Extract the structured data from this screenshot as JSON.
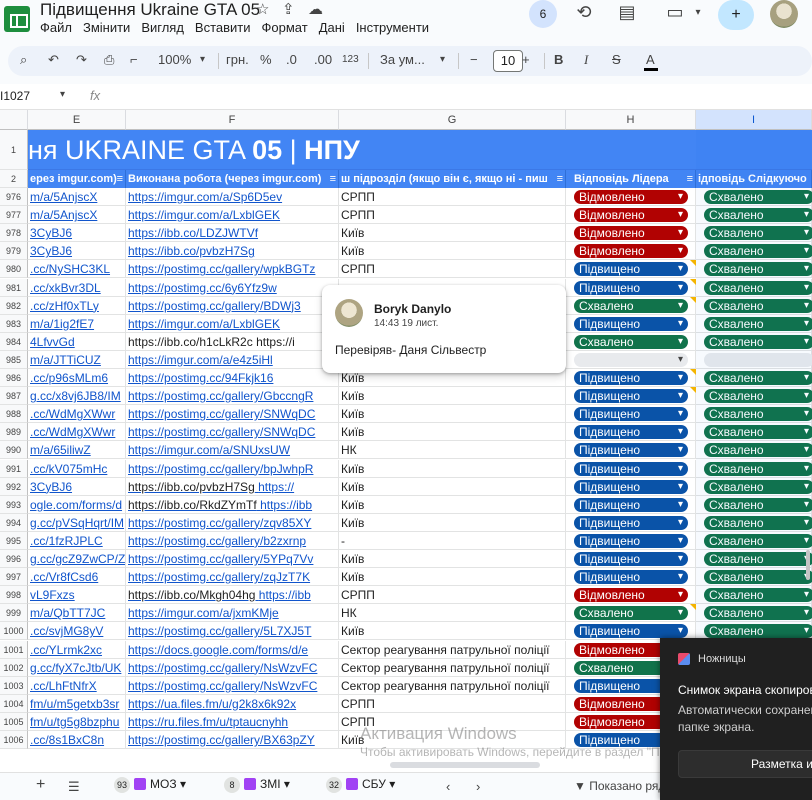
{
  "app": {
    "title": "Підвищення Ukraine GTA 05",
    "menu": [
      "Файл",
      "Змінити",
      "Вигляд",
      "Вставити",
      "Формат",
      "Дані",
      "Інструменти"
    ],
    "collaborators_count": "6"
  },
  "toolbar": {
    "zoom": "100%",
    "currency": "грн.",
    "percent": "%",
    "decrease_decimals": ".0",
    "increase_decimals": ".00",
    "number_format": "123",
    "font": "За ум...",
    "font_size": "10",
    "minus": "−",
    "plus": "+",
    "bold": "B",
    "italic": "I",
    "strike": "S",
    "text_color": "A"
  },
  "formula_bar": {
    "name_box": "I1027",
    "fx": "fx"
  },
  "columns": [
    "E",
    "F",
    "G",
    "H",
    "I"
  ],
  "banner": {
    "prefix": "ня UKRAINE GTA ",
    "bold_num": "05",
    "sep": " | ",
    "suffix": "НПУ"
  },
  "header_row": {
    "row_num": "2",
    "e": "ерез imgur.com)",
    "f": "Виконана робота (через imgur.com)",
    "g": "ш підрозділ (якщо він є, якщо ні - пиш",
    "h": "Відповідь Лідера",
    "i": "ідповідь Слідкуючо"
  },
  "banner_row_num": "1",
  "rows": [
    {
      "n": "976",
      "e": "m/a/5AnjscX",
      "f": "https://imgur.com/a/Sp6D5ev",
      "g": "СРПП",
      "h": "Відмовлено",
      "hc": "red",
      "i": "Схвалено"
    },
    {
      "n": "977",
      "e": "m/a/5AnjscX",
      "f": "https://imgur.com/a/LxblGEK",
      "g": "СРПП",
      "h": "Відмовлено",
      "hc": "red",
      "i": "Схвалено"
    },
    {
      "n": "978",
      "e": "3CyBJ6",
      "f": "https://ibb.co/LDZJWTVf",
      "g": "Київ",
      "h": "Відмовлено",
      "hc": "red",
      "i": "Схвалено"
    },
    {
      "n": "979",
      "e": "3CyBJ6",
      "f": "https://ibb.co/pvbzH7Sg",
      "g": "Київ",
      "h": "Відмовлено",
      "hc": "red",
      "i": "Схвалено"
    },
    {
      "n": "980",
      "e": ".cc/NySHC3KL",
      "f": "https://postimg.cc/gallery/wpkBGTz",
      "g": "СРПП",
      "h": "Підвищено",
      "hc": "blue",
      "i": "Схвалено"
    },
    {
      "n": "981",
      "e": ".cc/xkBvr3DL",
      "f": "https://postimg.cc/6y6Yfz9w",
      "g": "",
      "h": "Підвищено",
      "hc": "blue",
      "i": "Схвалено"
    },
    {
      "n": "982",
      "e": ".cc/zHf0xTLy",
      "f": "https://postimg.cc/gallery/BDWj3",
      "g": "",
      "h": "Схвалено",
      "hc": "green",
      "i": "Схвалено"
    },
    {
      "n": "983",
      "e": "m/a/1ig2fE7",
      "f": "https://imgur.com/a/LxblGEK",
      "g": "",
      "h": "Підвищено",
      "hc": "blue",
      "i": "Схвалено"
    },
    {
      "n": "984",
      "e": "4LfvvGd",
      "f": "https://ibb.co/h1cLkR2c https://i",
      "g": "",
      "h": "Схвалено",
      "hc": "green",
      "i": "Схвалено"
    },
    {
      "n": "985",
      "e": "m/a/JTTiCUZ",
      "f": "https://imgur.com/a/e4z5iHl",
      "g": "",
      "h": "",
      "hc": "empty",
      "i": ""
    },
    {
      "n": "986",
      "e": ".cc/p96sMLm6",
      "f": "https://postimg.cc/94Fkjk16",
      "g": "Київ",
      "h": "Підвищено",
      "hc": "blue",
      "i": "Схвалено"
    },
    {
      "n": "987",
      "e": "g.cc/x8vj6JB8/IM",
      "f": "https://postimg.cc/gallery/GbccngR",
      "g": "Київ",
      "h": "Підвищено",
      "hc": "blue",
      "i": "Схвалено"
    },
    {
      "n": "988",
      "e": ".cc/WdMgXWwr",
      "f": "https://postimg.cc/gallery/SNWqDC",
      "g": "Київ",
      "h": "Підвищено",
      "hc": "blue",
      "i": "Схвалено"
    },
    {
      "n": "989",
      "e": ".cc/WdMgXWwr",
      "f": "https://postimg.cc/gallery/SNWqDC",
      "g": "Київ",
      "h": "Підвищено",
      "hc": "blue",
      "i": "Схвалено"
    },
    {
      "n": "990",
      "e": "m/a/65iliwZ",
      "f": "https://imgur.com/a/SNUxsUW",
      "g": "НК",
      "h": "Підвищено",
      "hc": "blue",
      "i": "Схвалено"
    },
    {
      "n": "991",
      "e": ".cc/kV075mHc",
      "f": "https://postimg.cc/gallery/bpJwhpR",
      "g": "Київ",
      "h": "Підвищено",
      "hc": "blue",
      "i": "Схвалено"
    },
    {
      "n": "992",
      "e": "3CyBJ6",
      "f": "https://ibb.co/pvbzH7Sg",
      "f2": "https://",
      "g": "Київ",
      "h": "Підвищено",
      "hc": "blue",
      "i": "Схвалено"
    },
    {
      "n": "993",
      "e": "ogle.com/forms/d",
      "f": "https://ibb.co/RkdZYmTf",
      "f2": "https://ibb",
      "g": "Київ",
      "h": "Підвищено",
      "hc": "blue",
      "i": "Схвалено"
    },
    {
      "n": "994",
      "e": "g.cc/pVSqHqrt/IM",
      "f": "https://postimg.cc/gallery/zqv85XY",
      "g": "Київ",
      "h": "Підвищено",
      "hc": "blue",
      "i": "Схвалено"
    },
    {
      "n": "995",
      "e": ".cc/1fzRJPLC",
      "f": "https://postimg.cc/gallery/b2zxrnp",
      "g": "-",
      "h": "Підвищено",
      "hc": "blue",
      "i": "Схвалено"
    },
    {
      "n": "996",
      "e": "g.cc/gcZ9ZwCP/Z",
      "f": "https://postimg.cc/gallery/5YPq7Vv",
      "g": "Київ",
      "h": "Підвищено",
      "hc": "blue",
      "i": "Схвалено"
    },
    {
      "n": "997",
      "e": ".cc/Vr8fCsd6",
      "f": "https://postimg.cc/gallery/zqJzT7K",
      "g": "Київ",
      "h": "Підвищено",
      "hc": "blue",
      "i": "Схвалено"
    },
    {
      "n": "998",
      "e": "vL9Fxzs",
      "f": "https://ibb.co/Mkgh04hg",
      "f2": "https://ibb",
      "g": "СРПП",
      "h": "Відмовлено",
      "hc": "red",
      "i": "Схвалено"
    },
    {
      "n": "999",
      "e": "m/a/QbTT7JC",
      "f": "https://imgur.com/a/jxmKMje",
      "g": "НК",
      "h": "Схвалено",
      "hc": "green",
      "i": "Схвалено"
    },
    {
      "n": "1000",
      "e": ".cc/svjMG8yV",
      "f": "https://postimg.cc/gallery/5L7XJ5T",
      "g": "Київ",
      "h": "Підвищено",
      "hc": "blue",
      "i": "Схвалено"
    },
    {
      "n": "1001",
      "e": ".cc/YLrmk2xc",
      "f": "https://docs.google.com/forms/d/e",
      "g": "Сектор реагування патрульної поліції",
      "h": "Відмовлено",
      "hc": "red",
      "i": ""
    },
    {
      "n": "1002",
      "e": "g.cc/fyX7cJtb/UK",
      "f": "https://postimg.cc/gallery/NsWzvFC",
      "g": "Сектор реагування патрульної поліції",
      "h": "Схвалено",
      "hc": "green",
      "i": ""
    },
    {
      "n": "1003",
      "e": ".cc/LhFtNfrX",
      "f": "https://postimg.cc/gallery/NsWzvFC",
      "g": "Сектор реагування патрульної поліції",
      "h": "Підвищено",
      "hc": "blue",
      "i": ""
    },
    {
      "n": "1004",
      "e": "fm/u/m5getxb3sr",
      "f": "https://ua.files.fm/u/g2k8x6k92x",
      "g": "СРПП",
      "h": "Відмовлено",
      "hc": "red",
      "i": ""
    },
    {
      "n": "1005",
      "e": "fm/u/tg5g8bzphu",
      "f": "https://ru.files.fm/u/tptaucnyhh",
      "g": "СРПП",
      "h": "Відмовлено",
      "hc": "red",
      "i": ""
    },
    {
      "n": "1006",
      "e": ".cc/8s1BxC8n",
      "f": "https://postimg.cc/gallery/BX63pZY",
      "g": "Київ",
      "h": "Підвищено",
      "hc": "blue",
      "i": ""
    }
  ],
  "comment": {
    "author": "Boryk Danylo",
    "time": "14:43 19 лист.",
    "text": "Перевіряв- Даня Сільвестр"
  },
  "sheets": [
    {
      "count": "93",
      "name": "МОЗ"
    },
    {
      "count": "8",
      "name": "ЗМІ"
    },
    {
      "count": "32",
      "name": "СБУ"
    }
  ],
  "bottom": {
    "add": "+",
    "list": "☰",
    "shown": "Показано ряд"
  },
  "windows": {
    "activate_title": "Активация Windows",
    "activate_text": "Чтобы активировать Windows, перейдите в раздел \"Параметры\".",
    "toast_app": "Ножницы",
    "toast_title": "Снимок экрана скопиров",
    "toast_body": "Автоматически сохранен в папке экрана.",
    "toast_button": "Разметка и"
  }
}
